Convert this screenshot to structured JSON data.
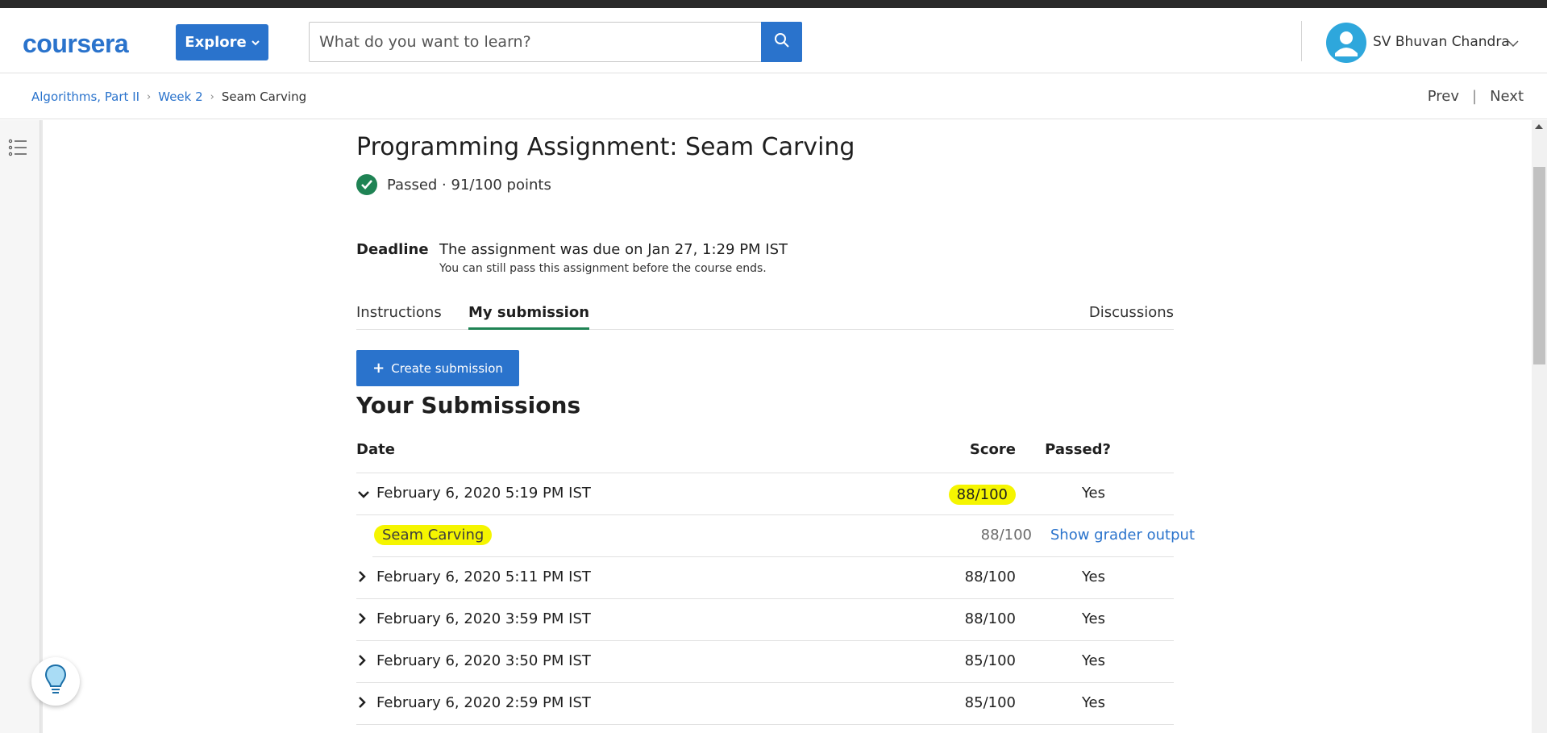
{
  "header": {
    "logo_text": "coursera",
    "explore_label": "Explore",
    "search_placeholder": "What do you want to learn?",
    "user_name": "SV Bhuvan Chandra"
  },
  "breadcrumb": {
    "items": [
      "Algorithms, Part II",
      "Week 2",
      "Seam Carving"
    ],
    "prev_label": "Prev",
    "next_label": "Next"
  },
  "assignment": {
    "title": "Programming Assignment: Seam Carving",
    "status": "Passed · 91/100 points",
    "deadline_label": "Deadline",
    "deadline_text": "The assignment was due on Jan 27, 1:29 PM IST",
    "deadline_sub": "You can still pass this assignment before the course ends."
  },
  "tabs": {
    "instructions": "Instructions",
    "my_submission": "My submission",
    "discussions": "Discussions"
  },
  "create_submission_label": "Create submission",
  "submissions": {
    "title": "Your Submissions",
    "headers": {
      "date": "Date",
      "score": "Score",
      "passed": "Passed?"
    },
    "rows": [
      {
        "date": "February 6, 2020 5:19 PM IST",
        "score": "88/100",
        "passed": "Yes",
        "expanded": true
      },
      {
        "date": "February 6, 2020 5:11 PM IST",
        "score": "88/100",
        "passed": "Yes",
        "expanded": false
      },
      {
        "date": "February 6, 2020 3:59 PM IST",
        "score": "88/100",
        "passed": "Yes",
        "expanded": false
      },
      {
        "date": "February 6, 2020 3:50 PM IST",
        "score": "85/100",
        "passed": "Yes",
        "expanded": false
      },
      {
        "date": "February 6, 2020 2:59 PM IST",
        "score": "85/100",
        "passed": "Yes",
        "expanded": false
      }
    ],
    "expanded_part": {
      "name": "Seam Carving",
      "score": "88/100",
      "grader_link": "Show grader output"
    }
  },
  "colors": {
    "brand_blue": "#2a73cc",
    "success_green": "#1f8354",
    "highlight_yellow": "#f5f500"
  }
}
